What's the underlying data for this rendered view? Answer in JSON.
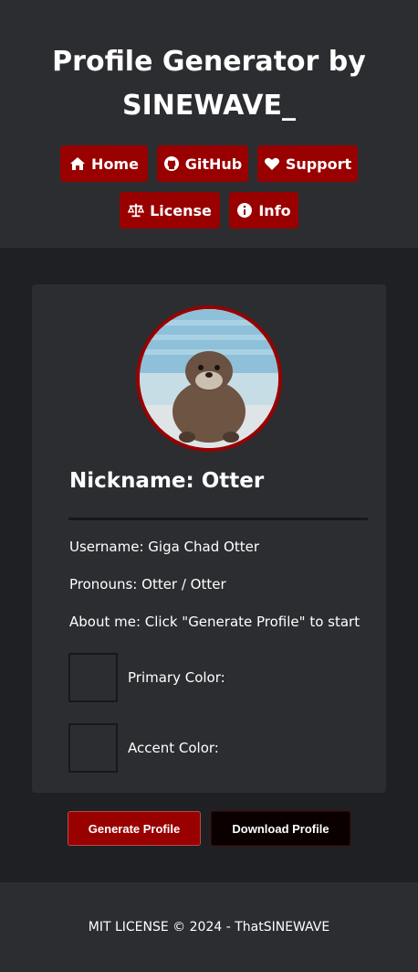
{
  "header": {
    "title_line1": "Profile Generator by",
    "title_line2": "SINEWAVE_",
    "nav": [
      {
        "label": "Home",
        "icon": "home-icon"
      },
      {
        "label": "GitHub",
        "icon": "github-icon"
      },
      {
        "label": "Support",
        "icon": "heart-icon"
      },
      {
        "label": "License",
        "icon": "scale-icon"
      },
      {
        "label": "Info",
        "icon": "info-icon"
      }
    ]
  },
  "profile": {
    "nickname": "Nickname: Otter",
    "username": "Username: Giga Chad Otter",
    "pronouns": "Pronouns: Otter / Otter",
    "about": "About me: Click \"Generate Profile\" to start",
    "primary_color_label": "Primary Color:",
    "accent_color_label": "Accent Color:"
  },
  "actions": {
    "generate_label": "Generate Profile",
    "download_label": "Download Profile"
  },
  "footer": {
    "text": "MIT LICENSE © 2024 - ThatSINEWAVE"
  },
  "colors": {
    "accent": "#990000",
    "background": "#1f2024",
    "panel": "#2c2d31"
  }
}
